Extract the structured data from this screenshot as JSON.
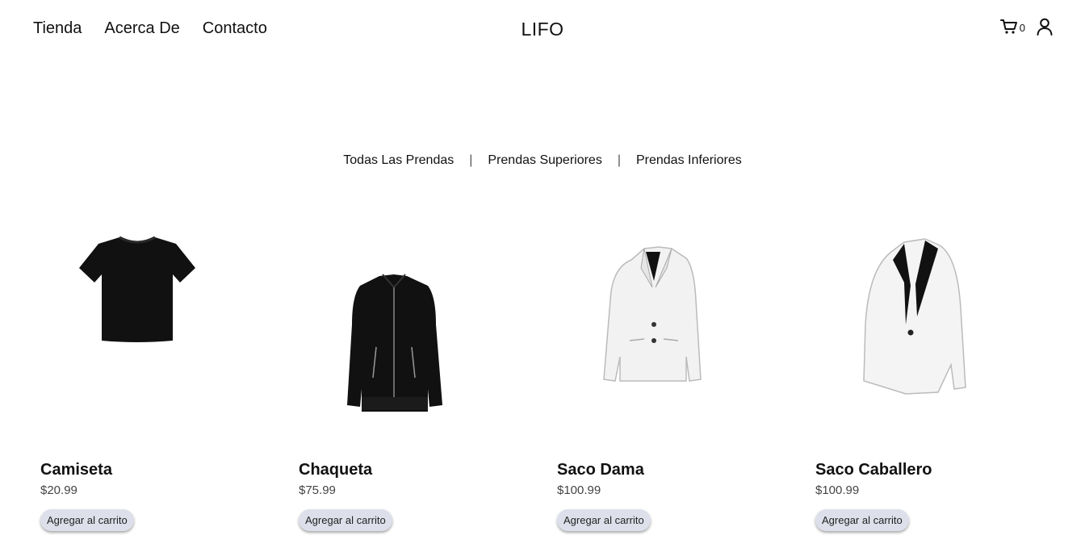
{
  "nav": {
    "links": [
      "Tienda",
      "Acerca De",
      "Contacto"
    ],
    "brand": "LIFO",
    "cart_icon": "shopping-cart-icon",
    "cart_count": "0",
    "user_icon": "user-icon"
  },
  "filters": {
    "items": [
      "Todas Las Prendas",
      "Prendas Superiores",
      "Prendas Inferiores"
    ],
    "separator": "|"
  },
  "products": [
    {
      "name": "Camiseta",
      "price": "$20.99",
      "button": "Agregar al carrito",
      "image": "black-tshirt"
    },
    {
      "name": "Chaqueta",
      "price": "$75.99",
      "button": "Agregar al carrito",
      "image": "black-jacket"
    },
    {
      "name": "Saco Dama",
      "price": "$100.99",
      "button": "Agregar al carrito",
      "image": "white-womens-blazer"
    },
    {
      "name": "Saco Caballero",
      "price": "$100.99",
      "button": "Agregar al carrito",
      "image": "white-mens-tuxedo-jacket"
    }
  ]
}
